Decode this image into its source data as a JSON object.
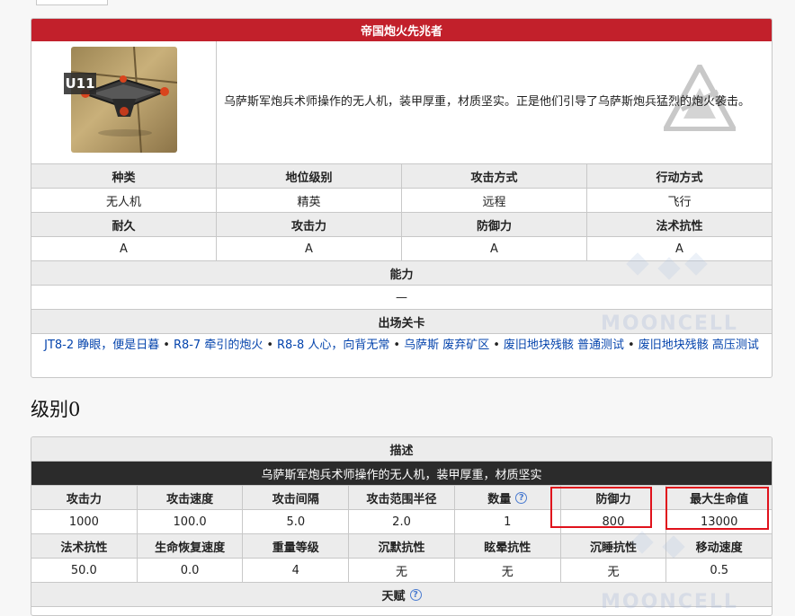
{
  "card1": {
    "title": "帝国炮火先兆者",
    "enemy_code": "U11",
    "description": "乌萨斯军炮兵术师操作的无人机，装甲厚重，材质坚实。正是他们引导了乌萨斯炮兵猛烈的炮火袭击。",
    "row1_headers": [
      "种类",
      "地位级别",
      "攻击方式",
      "行动方式"
    ],
    "row1_values": [
      "无人机",
      "精英",
      "远程",
      "飞行"
    ],
    "row2_headers": [
      "耐久",
      "攻击力",
      "防御力",
      "法术抗性"
    ],
    "row2_values": [
      "A",
      "A",
      "A",
      "A"
    ],
    "ability_header": "能力",
    "ability_value": "—",
    "stages_header": "出场关卡",
    "stages": [
      "JT8-2 睁眼，便是日暮",
      "R8-7 牵引的炮火",
      "R8-8 人心，向背无常",
      "乌萨斯 废弃矿区",
      "废旧地块残骸 普通测试",
      "废旧地块残骸 高压测试"
    ],
    "stage_separator": "•"
  },
  "level_title": "级别0",
  "card2": {
    "desc_header": "描述",
    "desc_text": "乌萨斯军炮兵术师操作的无人机，装甲厚重，材质坚实",
    "row1_headers": [
      "攻击力",
      "攻击速度",
      "攻击间隔",
      "攻击范围半径",
      "数量",
      "防御力",
      "最大生命值"
    ],
    "row1_values": [
      "1000",
      "100.0",
      "5.0",
      "2.0",
      "1",
      "800",
      "13000"
    ],
    "row2_headers": [
      "法术抗性",
      "生命恢复速度",
      "重量等级",
      "沉默抗性",
      "眩晕抗性",
      "沉睡抗性",
      "移动速度"
    ],
    "row2_values": [
      "50.0",
      "0.0",
      "4",
      "无",
      "无",
      "无",
      "0.5"
    ],
    "talent_header": "天赋",
    "help_glyph": "?"
  },
  "watermark_text": "MOONCELL",
  "colors": {
    "title_red": "#c2202b",
    "dark_bar": "#2b2b2b",
    "highlight_red": "#e0121c",
    "link_blue": "#0645ad"
  }
}
